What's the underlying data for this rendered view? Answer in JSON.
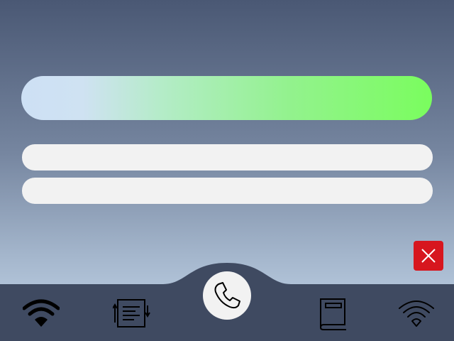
{
  "progress": {
    "level": 1.0,
    "colors": {
      "start": "#cde0f5",
      "end": "#7afd5e"
    }
  },
  "fields": [
    {
      "value": "",
      "placeholder": ""
    },
    {
      "value": "",
      "placeholder": ""
    }
  ],
  "close_button": {
    "icon": "close-icon",
    "color": "#d7161e"
  },
  "dock": {
    "background": "#3f4a61",
    "items": [
      {
        "icon": "wifi-filled-icon"
      },
      {
        "icon": "sort-list-icon"
      },
      {
        "icon": "phone-icon"
      },
      {
        "icon": "book-icon"
      },
      {
        "icon": "wifi-outline-icon"
      }
    ]
  }
}
